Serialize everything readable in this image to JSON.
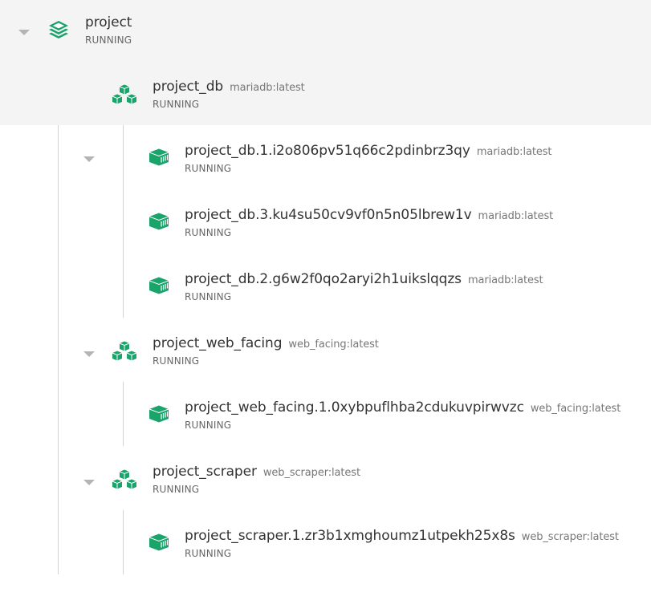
{
  "accent_color": "#1aa36b",
  "project": {
    "name": "project",
    "status": "RUNNING",
    "icon": "layers-icon"
  },
  "services": [
    {
      "name": "project_db",
      "image": "mariadb:latest",
      "status": "RUNNING",
      "icon": "cubes-icon",
      "tasks": [
        {
          "name": "project_db.1.i2o806pv51q66c2pdinbrz3qy",
          "image": "mariadb:latest",
          "status": "RUNNING",
          "icon": "container-icon"
        },
        {
          "name": "project_db.3.ku4su50cv9vf0n5n05lbrew1v",
          "image": "mariadb:latest",
          "status": "RUNNING",
          "icon": "container-icon"
        },
        {
          "name": "project_db.2.g6w2f0qo2aryi2h1uikslqqzs",
          "image": "mariadb:latest",
          "status": "RUNNING",
          "icon": "container-icon"
        }
      ]
    },
    {
      "name": "project_web_facing",
      "image": "web_facing:latest",
      "status": "RUNNING",
      "icon": "cubes-icon",
      "tasks": [
        {
          "name": "project_web_facing.1.0xybpuflhba2cdukuvpirwvzc",
          "image": "web_facing:latest",
          "status": "RUNNING",
          "icon": "container-icon"
        }
      ]
    },
    {
      "name": "project_scraper",
      "image": "web_scraper:latest",
      "status": "RUNNING",
      "icon": "cubes-icon",
      "tasks": [
        {
          "name": "project_scraper.1.zr3b1xmghoumz1utpekh25x8s",
          "image": "web_scraper:latest",
          "status": "RUNNING",
          "icon": "container-icon"
        }
      ]
    }
  ]
}
